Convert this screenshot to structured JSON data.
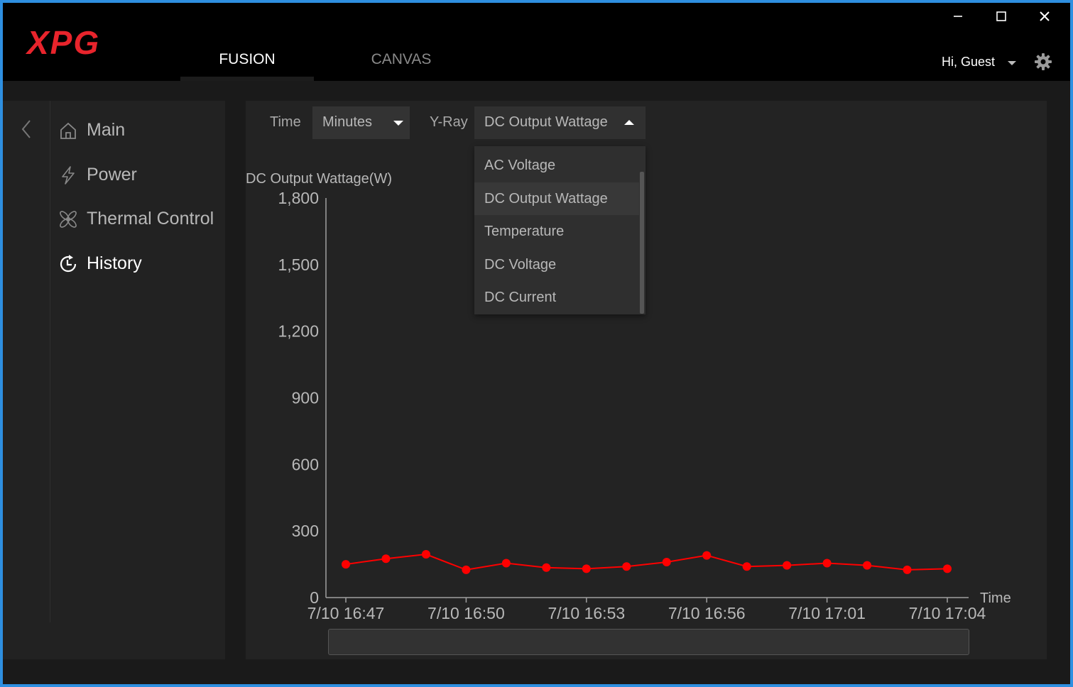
{
  "app": {
    "logo_text": "XPG",
    "brand_color": "#e8242c",
    "tabs": [
      {
        "label": "FUSION",
        "active": true
      },
      {
        "label": "CANVAS",
        "active": false
      }
    ],
    "user": {
      "greeting": "Hi, Guest"
    },
    "window_controls": [
      "minimize-icon",
      "maximize-icon",
      "close-icon"
    ]
  },
  "sidebar": {
    "items": [
      {
        "label": "Main",
        "icon": "home-icon",
        "active": false
      },
      {
        "label": "Power",
        "icon": "lightning-icon",
        "active": false
      },
      {
        "label": "Thermal Control",
        "icon": "fan-icon",
        "active": false
      },
      {
        "label": "History",
        "icon": "history-clock-icon",
        "active": true
      }
    ]
  },
  "controls": {
    "time_label": "Time",
    "time_value": "Minutes",
    "yray_label": "Y-Ray",
    "yray_value": "DC Output Wattage",
    "yray_options": [
      "AC Voltage",
      "DC Output Wattage",
      "Temperature",
      "DC Voltage",
      "DC Current"
    ],
    "yray_selected_index": 1
  },
  "chart_data": {
    "type": "line",
    "ylabel": "DC Output Wattage(W)",
    "xlabel": "Time",
    "ylim": [
      0,
      1800
    ],
    "yticks": [
      "0",
      "300",
      "600",
      "900",
      "1,200",
      "1,500",
      "1,800"
    ],
    "xticks": [
      "7/10 16:47",
      "7/10 16:50",
      "7/10 16:53",
      "7/10 16:56",
      "7/10 17:01",
      "7/10 17:04"
    ],
    "series": [
      {
        "color": "#ff0000",
        "values": [
          150,
          175,
          195,
          125,
          155,
          135,
          130,
          140,
          160,
          190,
          140,
          145,
          155,
          145,
          125,
          130
        ]
      }
    ]
  }
}
